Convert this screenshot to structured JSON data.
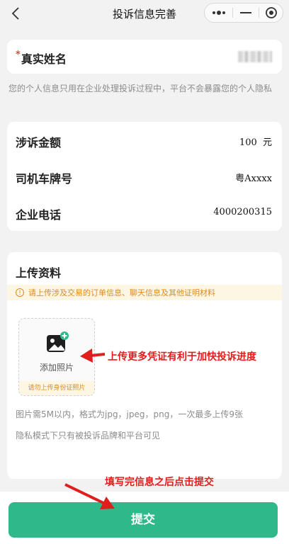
{
  "nav": {
    "title": "投诉信息完善",
    "back_icon": "chevron-left-icon",
    "capsule_icons": [
      "more-dots-icon",
      "minimize-icon",
      "close-circle-icon"
    ]
  },
  "name_field": {
    "required_mark": "*",
    "label": "真实姓名",
    "value_blurred": true
  },
  "privacy_note": "您的个人信息只用在企业处理投诉过程中，平台不会暴露您的个人隐私",
  "info_rows": [
    {
      "label": "涉诉金额",
      "value": "100  元"
    },
    {
      "label": "司机车牌号",
      "value": "粤Axxxx"
    },
    {
      "label": "企业电话",
      "value": "4000200315"
    }
  ],
  "upload": {
    "title": "上传资料",
    "warning_icon": "!",
    "warning": "请上传涉及交易的订单信息、聊天信息及其他证明材料",
    "add_photo_label": "添加照片",
    "id_warning": "请勿上传身份证照片",
    "rule_text": "图片需5M以内，格式为jpg，jpeg，png，一次最多上传9张",
    "privacy_mode_text": "隐私模式下只有被投诉品牌和平台可见"
  },
  "annotations": {
    "upload_hint": "上传更多凭证有利于加快投诉进度",
    "submit_hint": "填写完信息之后点击提交"
  },
  "submit": {
    "label": "提交"
  },
  "colors": {
    "accent": "#2fb88a",
    "required": "#e04b3c",
    "warning": "#e08a1e",
    "annotation": "#e01e1e"
  }
}
